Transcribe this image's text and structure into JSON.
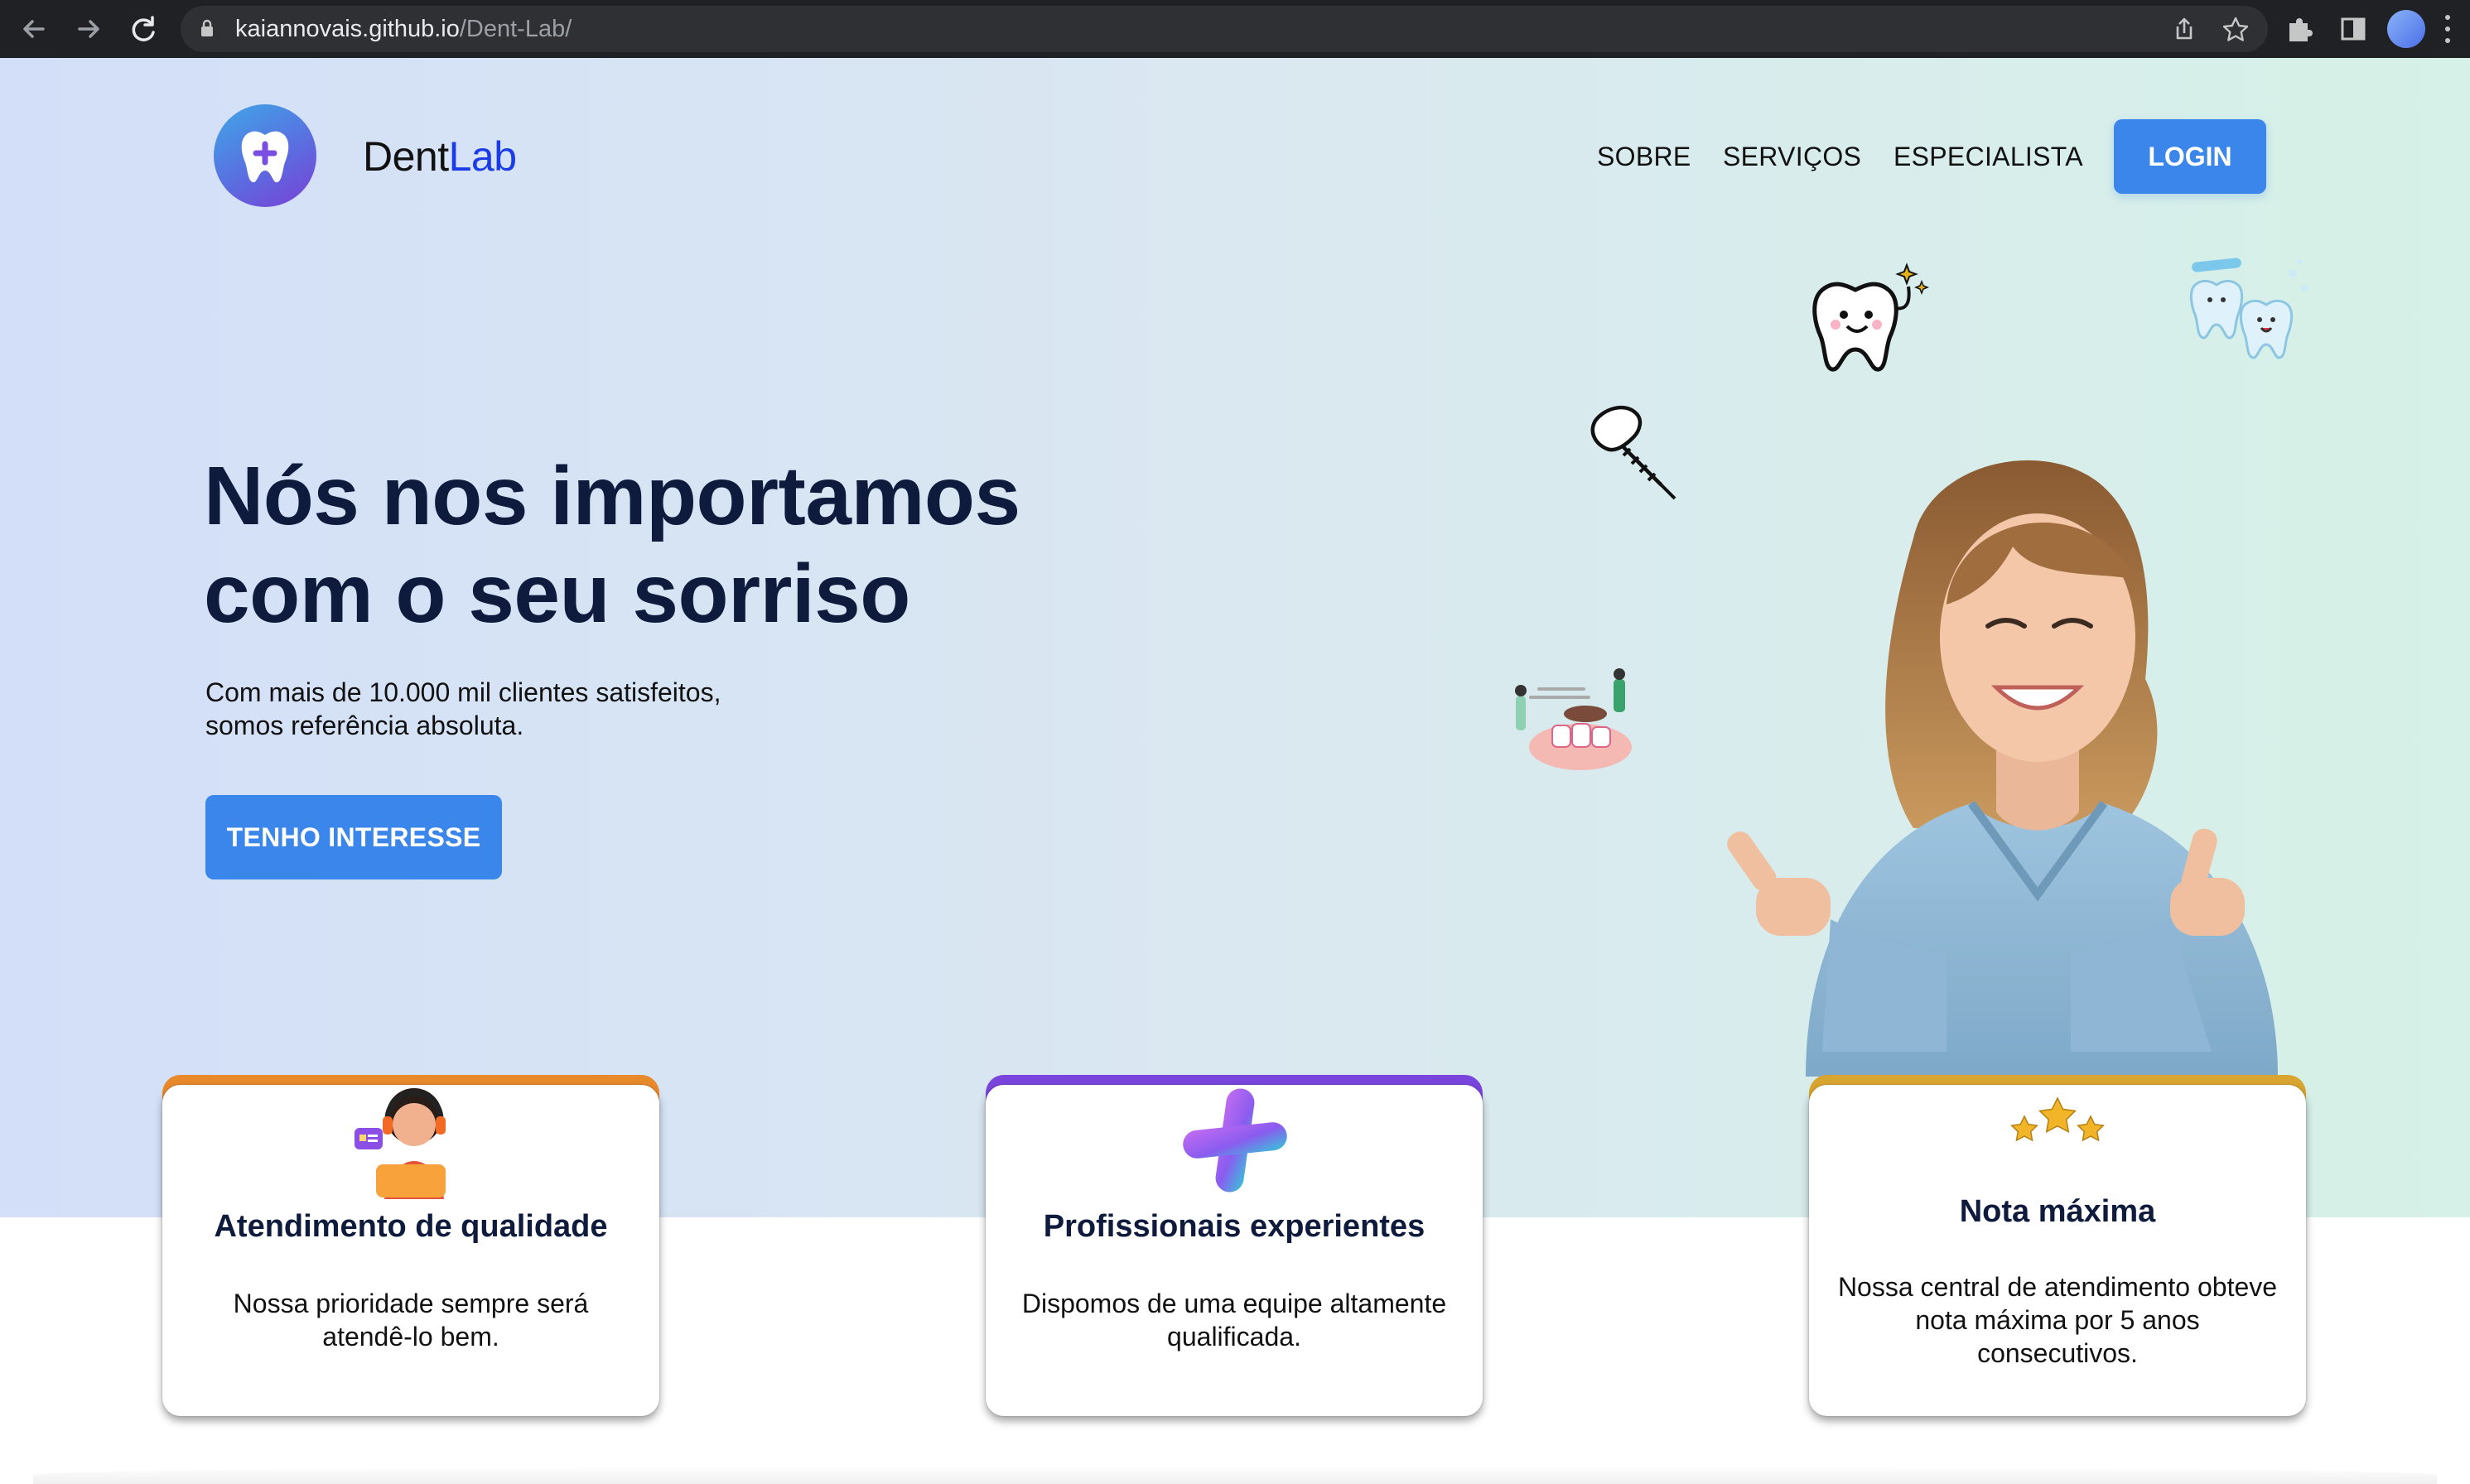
{
  "browser": {
    "url_host": "kaiannovais.github.io",
    "url_path": "/Dent-Lab/",
    "icons": [
      "back-arrow-icon",
      "forward-arrow-icon",
      "reload-icon",
      "lock-icon",
      "share-icon",
      "bookmark-star-icon",
      "extensions-puzzle-icon",
      "sidebar-icon",
      "profile-avatar",
      "more-menu-icon"
    ]
  },
  "header": {
    "brand_prefix": "Dent",
    "brand_suffix": "Lab",
    "nav": [
      "SOBRE",
      "SERVIÇOS",
      "ESPECIALISTA"
    ],
    "login_label": "LOGIN"
  },
  "hero": {
    "headline_line1": "Nós nos importamos",
    "headline_line2": "com o seu sorriso",
    "subtitle_line1": "Com mais de 10.000 mil clientes satisfeitos,",
    "subtitle_line2": "somos referência absoluta.",
    "cta_label": "TENHO INTERESSE"
  },
  "cards": [
    {
      "title": "Atendimento de qualidade",
      "text_line1": "Nossa prioridade sempre será",
      "text_line2": "atendê-lo bem.",
      "text_line3": "",
      "accent": "#e8892b",
      "icon": "support-agent-icon"
    },
    {
      "title": "Profissionais experientes",
      "text_line1": "Dispomos de uma equipe altamente",
      "text_line2": "qualificada.",
      "text_line3": "",
      "accent": "#7a45dc",
      "icon": "medical-cross-icon"
    },
    {
      "title": "Nota máxima",
      "text_line1": "Nossa central de atendimento obteve",
      "text_line2": "nota máxima por 5 anos",
      "text_line3": "consecutivos.",
      "accent": "#d9a531",
      "icon": "three-stars-icon"
    }
  ],
  "colors": {
    "primary_button": "#3b86ea",
    "headline": "#0f1b3d",
    "brand_accent": "#1a3be6",
    "hero_gradient_start": "#d3dff8",
    "hero_gradient_end": "#d6f1e7"
  }
}
